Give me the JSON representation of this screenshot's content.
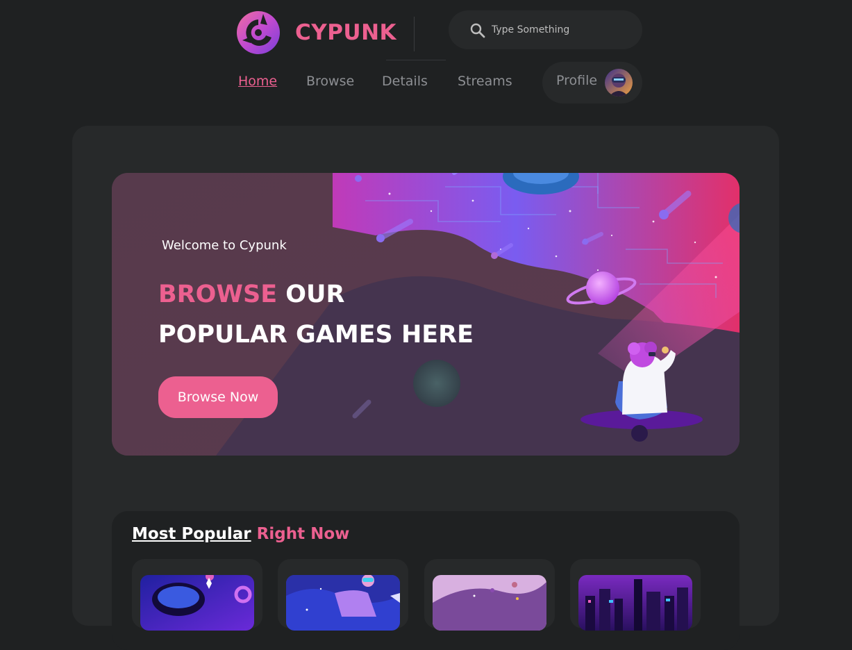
{
  "brand": {
    "name": "CYPUNK",
    "accent_color": "#ec6090"
  },
  "search": {
    "placeholder": "Type Something",
    "icon": "search-icon"
  },
  "nav": {
    "items": [
      {
        "label": "Home",
        "active": true
      },
      {
        "label": "Browse",
        "active": false
      },
      {
        "label": "Details",
        "active": false
      },
      {
        "label": "Streams",
        "active": false
      }
    ],
    "profile_label": "Profile"
  },
  "banner": {
    "welcome": "Welcome to Cypunk",
    "title_accent": "BROWSE",
    "title_rest": " OUR",
    "title_line2": "POPULAR GAMES HERE",
    "button_label": "Browse Now"
  },
  "popular": {
    "heading_em": "Most Popular",
    "heading_accent": "Right Now",
    "games": [
      {
        "thumb": "vr-headset-thumb"
      },
      {
        "thumb": "space-girl-thumb"
      },
      {
        "thumb": "galaxy-hair-thumb"
      },
      {
        "thumb": "neon-city-thumb"
      }
    ]
  }
}
